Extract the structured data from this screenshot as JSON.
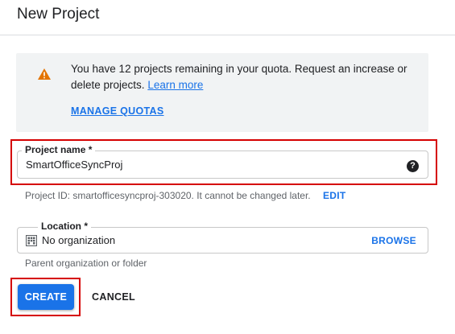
{
  "dialog": {
    "title": "New Project"
  },
  "quota_banner": {
    "icon": "warning-icon",
    "message": "You have 12 projects remaining in your quota. Request an increase or delete projects.",
    "learn_more": "Learn more",
    "manage_quotas": "MANAGE QUOTAS"
  },
  "project_name": {
    "label": "Project name *",
    "value": "SmartOfficeSyncProj",
    "help_icon": "help-icon",
    "help_glyph": "?",
    "highlighted": true
  },
  "project_id": {
    "hint": "Project ID: smartofficesyncproj-303020. It cannot be changed later.",
    "edit_label": "EDIT"
  },
  "location": {
    "label": "Location *",
    "value": "No organization",
    "icon": "organization-icon",
    "browse_label": "BROWSE",
    "hint": "Parent organization or folder"
  },
  "actions": {
    "create_label": "CREATE",
    "cancel_label": "CANCEL",
    "create_highlighted": true
  },
  "colors": {
    "accent": "#1a73e8",
    "warning": "#e37400",
    "highlight": "#d50000",
    "banner_bg": "#f1f3f4"
  }
}
